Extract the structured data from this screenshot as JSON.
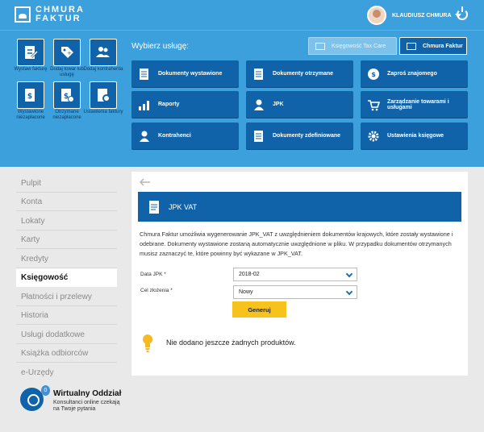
{
  "header": {
    "logo_line1": "CHMURA",
    "logo_line2": "FAKTUR",
    "user_name": "KLAUDIUSZ CHMURA"
  },
  "quick": [
    {
      "label": "Wystaw fakturę"
    },
    {
      "label": "Dodaj towar lub usługę"
    },
    {
      "label": "Dodaj kontrahenta"
    },
    {
      "label": "Wystawione niezapłacone"
    },
    {
      "label": "Otrzymane niezapłacone"
    },
    {
      "label": "Ustawienia faktury"
    }
  ],
  "services": {
    "heading": "Wybierz usługę:",
    "tabs": [
      {
        "label": "Księgowość Tax Care"
      },
      {
        "label": "Chmura Faktur"
      }
    ],
    "items": [
      {
        "label": "Dokumenty wystawione"
      },
      {
        "label": "Dokumenty otrzymane"
      },
      {
        "label": "Zaproś znajomego"
      },
      {
        "label": "Raporty"
      },
      {
        "label": "JPK"
      },
      {
        "label": "Zarządzanie towarami i usługami"
      },
      {
        "label": "Kontrahenci"
      },
      {
        "label": "Dokumenty zdefiniowane"
      },
      {
        "label": "Ustawienia księgowe"
      }
    ]
  },
  "sidebar": {
    "items": [
      {
        "label": "Pulpit"
      },
      {
        "label": "Konta"
      },
      {
        "label": "Lokaty"
      },
      {
        "label": "Karty"
      },
      {
        "label": "Kredyty"
      },
      {
        "label": "Księgowość"
      },
      {
        "label": "Płatności i przelewy"
      },
      {
        "label": "Historia"
      },
      {
        "label": "Usługi dodatkowe"
      },
      {
        "label": "Książka odbiorców"
      },
      {
        "label": "e-Urzędy"
      }
    ],
    "virtual": {
      "badge": "0",
      "title": "Wirtualny Oddział",
      "subtitle": "Konsultanci online czekają na Twoje pytania"
    }
  },
  "main": {
    "title": "JPK VAT",
    "description": "Chmura Faktur umożliwia wygenerowanie JPK_VAT z uwzględnieniem dokumentów krajowych, które zostały wystawione i odebrane. Dokumenty wystawione zostaną automatycznie uwzględnione w pliku. W przypadku dokumentów otrzymanych musisz zaznaczyć te, które powinny być wykazane w JPK_VAT.",
    "date_label": "Data JPK *",
    "date_value": "2018-02",
    "purpose_label": "Cel złożenia *",
    "purpose_value": "Nowy",
    "generate_label": "Generuj",
    "empty_message": "Nie dodano jeszcze żadnych produktów."
  },
  "colors": {
    "header_blue": "#3ba0dc",
    "tile_blue": "#1063a8",
    "accent_yellow": "#f5c31b"
  }
}
